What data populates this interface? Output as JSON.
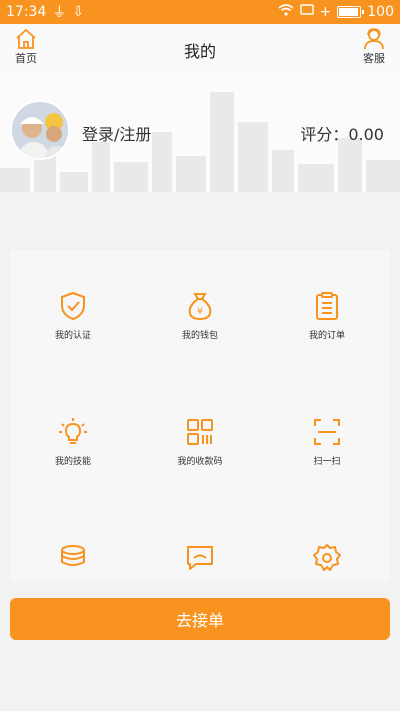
{
  "status_bar": {
    "time": "17:34",
    "battery_label": "100",
    "battery_level": 1.0
  },
  "header": {
    "title": "我的",
    "left_label": "首页",
    "right_label": "客服"
  },
  "profile": {
    "login_label": "登录/注册",
    "score_label": "评分：0.00"
  },
  "grid": [
    {
      "label": "我的认证",
      "icon": "shield-check-icon"
    },
    {
      "label": "我的钱包",
      "icon": "money-bag-icon"
    },
    {
      "label": "我的订单",
      "icon": "clipboard-list-icon"
    },
    {
      "label": "我的技能",
      "icon": "lightbulb-icon"
    },
    {
      "label": "我的收款码",
      "icon": "qr-code-icon"
    },
    {
      "label": "扫一扫",
      "icon": "scan-icon"
    },
    {
      "label": "",
      "icon": "coins-icon"
    },
    {
      "label": "",
      "icon": "chat-icon"
    },
    {
      "label": "",
      "icon": "settings-icon"
    }
  ],
  "action": {
    "label": "去接单"
  },
  "colors": {
    "accent": "#f7931e",
    "background": "#f2f2f2"
  }
}
